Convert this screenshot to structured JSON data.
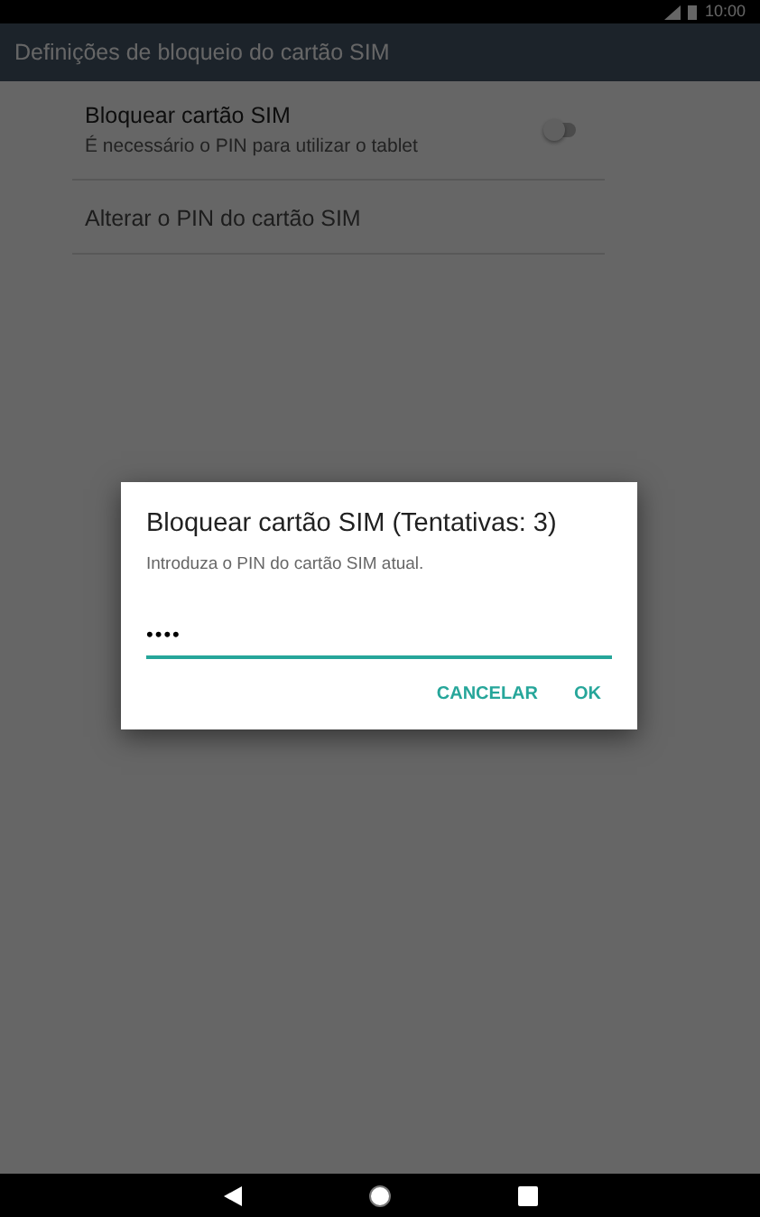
{
  "status_bar": {
    "time": "10:00"
  },
  "app_bar": {
    "title": "Definições de bloqueio do cartão SIM"
  },
  "settings": [
    {
      "kind": "switch",
      "title": "Bloquear cartão SIM",
      "summary": "É necessário o PIN para utilizar o tablet",
      "on": false,
      "disabled": false
    },
    {
      "kind": "plain",
      "title": "Alterar o PIN do cartão SIM",
      "disabled": true
    }
  ],
  "dialog": {
    "title": "Bloquear cartão SIM (Tentativas: 3)",
    "message": "Introduza o PIN do cartão SIM atual.",
    "pin_value": "••••",
    "buttons": [
      "CANCELAR",
      "OK"
    ]
  }
}
